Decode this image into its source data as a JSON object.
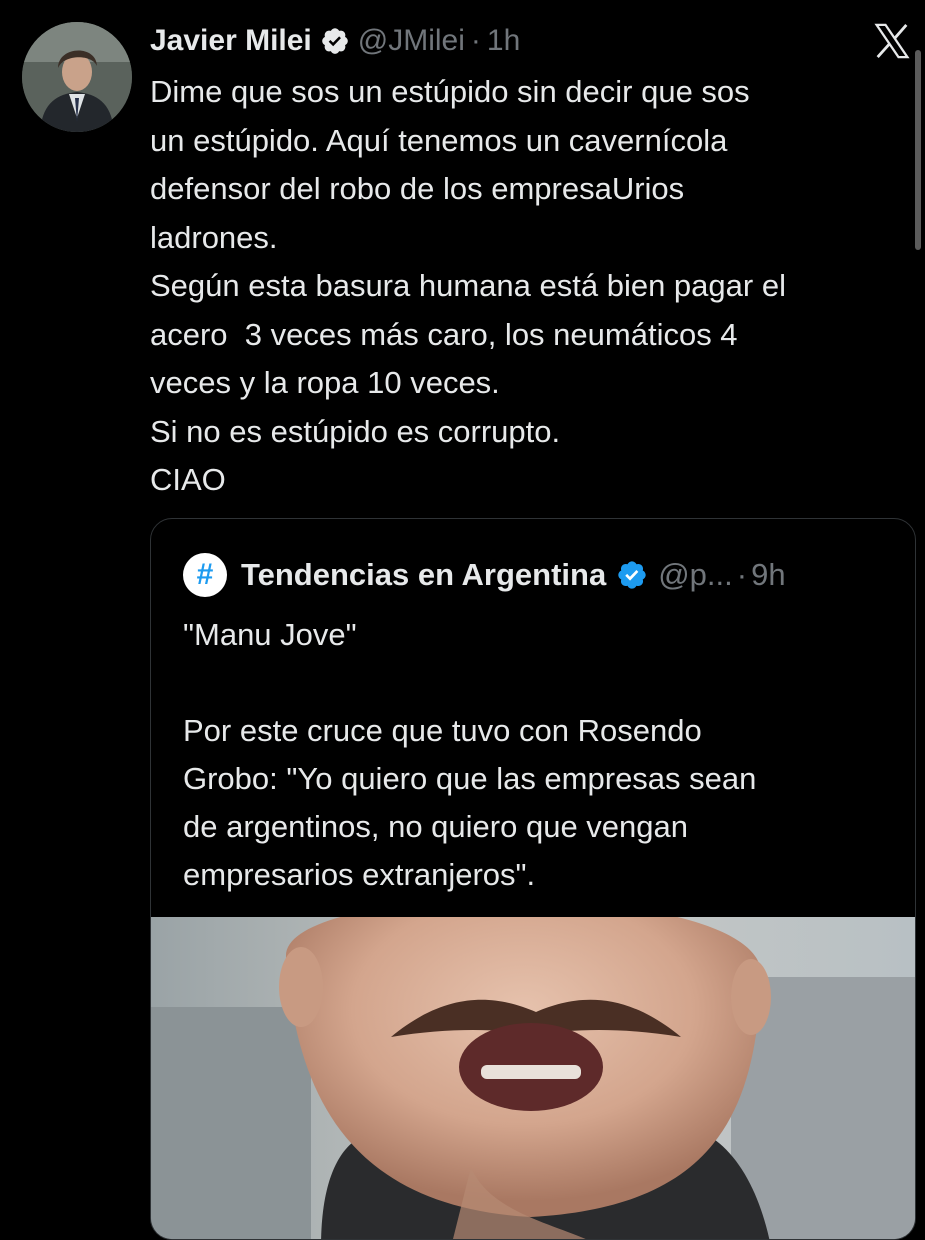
{
  "tweet": {
    "author_name": "Javier Milei",
    "handle": "@JMilei",
    "separator": "·",
    "time": "1h",
    "lines": [
      "Dime que sos un estúpido sin decir que sos",
      "un estúpido. Aquí tenemos un cavernícola",
      "defensor del robo de los empresaUrios",
      "ladrones.",
      "Según esta basura humana está bien pagar el",
      "acero  3 veces más caro, los neumáticos 4",
      "veces y la ropa 10 veces.",
      "Si no es estúpido es corrupto.",
      "CIAO"
    ]
  },
  "quote": {
    "avatar_symbol": "#",
    "author_name": "Tendencias en Argentina",
    "handle": "@p...",
    "separator": "·",
    "time": "9h",
    "title_line": "\"Manu Jove\"",
    "lines": [
      "Por este cruce que tuvo con Rosendo",
      "Grobo: \"Yo quiero que las empresas sean",
      "de argentinos, no quiero que vengan",
      "empresarios extranjeros\"."
    ]
  },
  "icons": {
    "verified": "verified-badge-icon",
    "close": "x-logo-icon"
  },
  "colors": {
    "background": "#000000",
    "text": "#e7e9ea",
    "muted": "#71767b",
    "verified_blue": "#1d9bf0",
    "border": "#2f3336"
  }
}
